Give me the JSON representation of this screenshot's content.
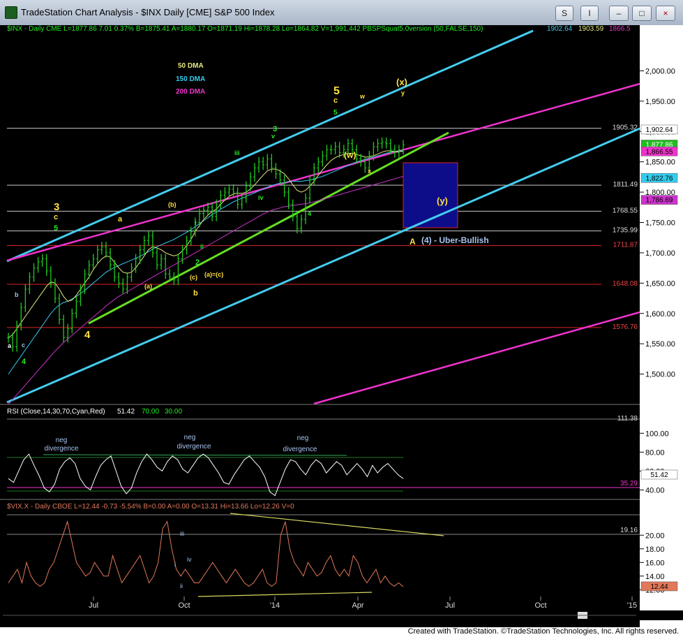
{
  "window": {
    "title": "TradeStation Chart Analysis - $INX Daily [CME] S&P 500 Index",
    "buttons": [
      "S",
      "I",
      "–",
      "□",
      "×"
    ]
  },
  "footer": "Created with TradeStation. ©TradeStation Technologies, Inc. All rights reserved.",
  "colors": {
    "background": "#000000",
    "price_bars": "#1fcc1f",
    "dma50": "#e8e880",
    "dma150": "#33ccee",
    "dma200": "#cc33cc",
    "channel": "#44ccee",
    "trendline": "#66dd22",
    "magenta_line": "#ee33cc",
    "target_box": "#0d0d8a",
    "vix": "#e0785a",
    "wave_label": "#ffe040"
  },
  "header": {
    "price": "$INX - Daily  CME  L=1877.86  7.01  0.37%  B=1875.41  A=1880.17  O=1871.19  Hi=1878.28  Lo=1864.82  V=1,991,442  PBSPSquat5.0version (50,FALSE,150)",
    "v1": "1902.64",
    "v2": "1903.59",
    "v3": "1866.5",
    "rsi": "RSI (Close,14,30,70,Cyan,Red)",
    "rsi_v": "51.42",
    "rsi_h": "70.00",
    "rsi_l": "30.00",
    "vix": "$VIX.X - Daily  CBOE  L=12.44  -0.73  -5.54%  B=0.00  A=0.00  O=13.31  Hi=13.66  Lo=12.26  V=0"
  },
  "chart_data": [
    {
      "type": "ohlc",
      "ylim": [
        1450,
        2050
      ],
      "yticks": [
        "2,000.00",
        "1,950.00",
        "1,900.00",
        "1,850.00",
        "1,800.00",
        "1,750.00",
        "1,700.00",
        "1,650.00",
        "1,600.00",
        "1,550.00",
        "1,500.00"
      ],
      "xticks": [
        "Jul",
        "Oct",
        "'14",
        "Apr",
        "Jul",
        "Oct",
        "'15"
      ],
      "legend": [
        "50 DMA",
        "150 DMA",
        "200 DMA"
      ],
      "price_levels": [
        "1905.32",
        "1811.49",
        "1768.55",
        "1735.99",
        "1711.87",
        "1648.08",
        "1576.76"
      ],
      "last_tags": [
        "1,902.64",
        "1,877.86",
        "1,866.55",
        "1,822.76",
        "1,786.69"
      ],
      "labels": [
        "3",
        "c",
        "5",
        "a",
        "(b)",
        "(a)",
        "i",
        "ii",
        "(c)",
        "(a)=(c)",
        "b",
        "2",
        "iii",
        "iv",
        "3",
        "v",
        "4",
        "5",
        "c",
        "5",
        "(w)",
        "w",
        "x",
        "(x)",
        "y",
        "(y)",
        "A",
        "(4) - Uber-Bullish",
        "a",
        "b",
        "c",
        "4",
        "4"
      ],
      "close": [
        1560,
        1545,
        1580,
        1610,
        1640,
        1660,
        1675,
        1685,
        1690,
        1670,
        1650,
        1625,
        1590,
        1560,
        1575,
        1600,
        1620,
        1640,
        1665,
        1680,
        1690,
        1705,
        1710,
        1700,
        1680,
        1660,
        1650,
        1640,
        1660,
        1675,
        1690,
        1705,
        1720,
        1728,
        1700,
        1680,
        1690,
        1665,
        1660,
        1655,
        1690,
        1705,
        1720,
        1735,
        1750,
        1765,
        1770,
        1775,
        1760,
        1780,
        1795,
        1800,
        1805,
        1800,
        1780,
        1790,
        1810,
        1825,
        1840,
        1850,
        1845,
        1855,
        1840,
        1830,
        1820,
        1800,
        1780,
        1760,
        1740,
        1755,
        1790,
        1820,
        1840,
        1850,
        1860,
        1870,
        1870,
        1875,
        1865,
        1870,
        1880,
        1870,
        1855,
        1850,
        1840,
        1860,
        1875,
        1880,
        1882,
        1880,
        1870,
        1865,
        1870,
        1878
      ],
      "dma50": [
        1560,
        1565,
        1575,
        1585,
        1595,
        1605,
        1615,
        1625,
        1635,
        1645,
        1652,
        1650,
        1640,
        1628,
        1620,
        1622,
        1630,
        1640,
        1650,
        1660,
        1672,
        1682,
        1690,
        1695,
        1693,
        1684,
        1675,
        1668,
        1666,
        1668,
        1675,
        1685,
        1695,
        1705,
        1710,
        1708,
        1705,
        1700,
        1697,
        1695,
        1697,
        1703,
        1712,
        1722,
        1735,
        1745,
        1755,
        1762,
        1768,
        1772,
        1780,
        1787,
        1793,
        1797,
        1798,
        1798,
        1800,
        1805,
        1812,
        1820,
        1828,
        1835,
        1838,
        1838,
        1835,
        1830,
        1822,
        1812,
        1803,
        1800,
        1803,
        1810,
        1818,
        1828,
        1837,
        1845,
        1852,
        1857,
        1860,
        1862,
        1864,
        1864,
        1862,
        1860,
        1858,
        1858,
        1860,
        1863,
        1866,
        1868,
        1868,
        1867,
        1867,
        1867
      ],
      "dma150": [
        1500,
        1510,
        1520,
        1530,
        1540,
        1550,
        1560,
        1570,
        1580,
        1590,
        1600,
        1608,
        1614,
        1618,
        1620,
        1624,
        1628,
        1633,
        1638,
        1644,
        1650,
        1656,
        1662,
        1668,
        1672,
        1676,
        1679,
        1682,
        1685,
        1688,
        1691,
        1694,
        1698,
        1702,
        1706,
        1710,
        1713,
        1716,
        1719,
        1722,
        1726,
        1730,
        1734,
        1738,
        1743,
        1748,
        1753,
        1758,
        1763,
        1767,
        1772,
        1776,
        1780,
        1784,
        1787,
        1790,
        1793,
        1796,
        1799,
        1802,
        1805,
        1808,
        1811,
        1813,
        1815,
        1816,
        1817,
        1818,
        1818,
        1818,
        1819,
        1820,
        1822,
        1824,
        1826,
        1829,
        1832,
        1835,
        1838,
        1841,
        1844,
        1847,
        1850,
        1852,
        1854,
        1856,
        1858,
        1860,
        1862,
        1864,
        1866,
        1867,
        1868,
        1868
      ],
      "dma200": [
        1450,
        1458,
        1466,
        1474,
        1482,
        1490,
        1498,
        1506,
        1514,
        1522,
        1530,
        1538,
        1545,
        1552,
        1558,
        1564,
        1570,
        1576,
        1582,
        1588,
        1594,
        1600,
        1606,
        1612,
        1618,
        1623,
        1628,
        1632,
        1636,
        1640,
        1644,
        1648,
        1652,
        1656,
        1660,
        1664,
        1668,
        1672,
        1676,
        1680,
        1684,
        1688,
        1692,
        1696,
        1700,
        1704,
        1708,
        1712,
        1716,
        1720,
        1724,
        1728,
        1732,
        1736,
        1740,
        1744,
        1748,
        1752,
        1756,
        1760,
        1764,
        1767,
        1770,
        1772,
        1774,
        1776,
        1777,
        1778,
        1779,
        1780,
        1781,
        1782,
        1784,
        1786,
        1788,
        1790,
        1792,
        1794,
        1796,
        1798,
        1800,
        1802,
        1804,
        1806,
        1808,
        1810,
        1812,
        1814,
        1816,
        1818,
        1820,
        1822,
        1824,
        1826
      ]
    },
    {
      "type": "line",
      "ylim": [
        30,
        115
      ],
      "yticks": [
        "100.00",
        "80.00",
        "60.00",
        "40.00"
      ],
      "tags": [
        "111.38",
        "51.42",
        "35.29"
      ],
      "labels": [
        "neg",
        "divergence",
        "neg",
        "divergence",
        "neg",
        "divergence"
      ],
      "values": [
        52,
        48,
        60,
        72,
        78,
        66,
        55,
        42,
        38,
        46,
        62,
        70,
        74,
        68,
        52,
        44,
        40,
        54,
        66,
        72,
        76,
        60,
        44,
        36,
        42,
        58,
        70,
        78,
        72,
        64,
        60,
        70,
        76,
        72,
        62,
        58,
        66,
        74,
        78,
        74,
        66,
        58,
        48,
        46,
        56,
        64,
        72,
        76,
        70,
        64,
        54,
        38,
        34,
        48,
        62,
        72,
        70,
        62,
        56,
        66,
        72,
        68,
        58,
        64,
        70,
        66,
        56,
        62,
        68,
        62,
        54,
        66,
        58,
        64,
        68,
        62,
        56,
        52
      ]
    },
    {
      "type": "line",
      "ylim": [
        11,
        23
      ],
      "yticks": [
        "20.00",
        "18.00",
        "16.00",
        "14.00",
        "12.00"
      ],
      "tags": [
        "19.16",
        "12.44"
      ],
      "labels": [
        "iii",
        "i",
        "ii",
        "iv"
      ],
      "values": [
        13,
        14,
        15,
        13,
        16,
        14,
        13,
        12.5,
        13,
        15,
        16,
        18,
        20,
        22,
        19,
        16,
        15,
        14,
        14.5,
        16,
        15,
        14,
        14,
        17,
        15,
        13,
        14,
        15,
        16,
        17,
        15,
        13,
        14,
        16,
        21,
        22,
        18,
        15,
        14,
        15,
        14,
        13,
        13,
        14,
        15,
        16,
        15,
        14,
        13,
        14,
        15,
        14,
        13,
        12.5,
        13,
        14,
        15,
        13,
        12.5,
        13,
        20,
        22,
        18,
        16,
        15,
        14,
        16,
        15,
        14,
        14.5,
        16,
        17,
        15,
        14,
        15,
        14,
        17,
        16,
        14,
        13,
        14,
        15,
        13,
        14,
        13,
        12.5,
        13,
        12.44
      ]
    }
  ]
}
